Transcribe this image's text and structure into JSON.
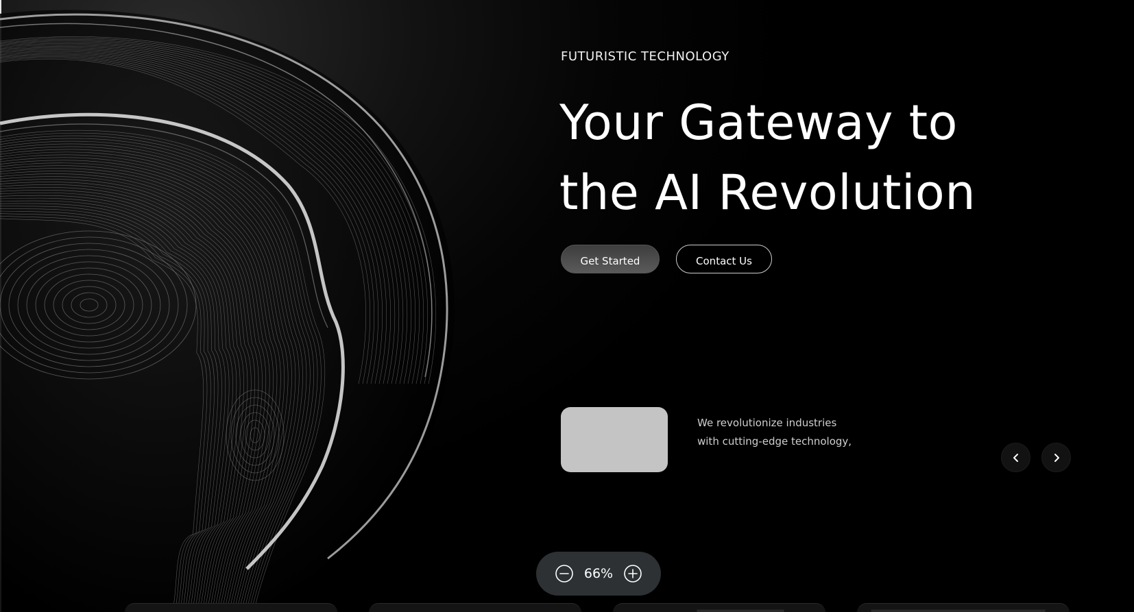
{
  "hero": {
    "eyebrow": "FUTURISTIC TECHNOLOGY",
    "headline_line1": "Your Gateway to",
    "headline_line2": "the AI Revolution",
    "primary_button": "Get Started",
    "secondary_button": "Contact Us"
  },
  "feature": {
    "text_line1": "We revolutionize industries",
    "text_line2": "with cutting-edge technology,"
  },
  "carousel": {
    "prev_icon": "chevron-left-icon",
    "next_icon": "chevron-right-icon"
  },
  "zoom": {
    "value": "66%",
    "minus_icon": "minus-circle-icon",
    "plus_icon": "plus-circle-icon"
  },
  "colors": {
    "background": "#000000",
    "button_primary": "#4a4a4a",
    "card_thumb": "#c4c4c4",
    "zoom_pill": "#2d3134"
  }
}
